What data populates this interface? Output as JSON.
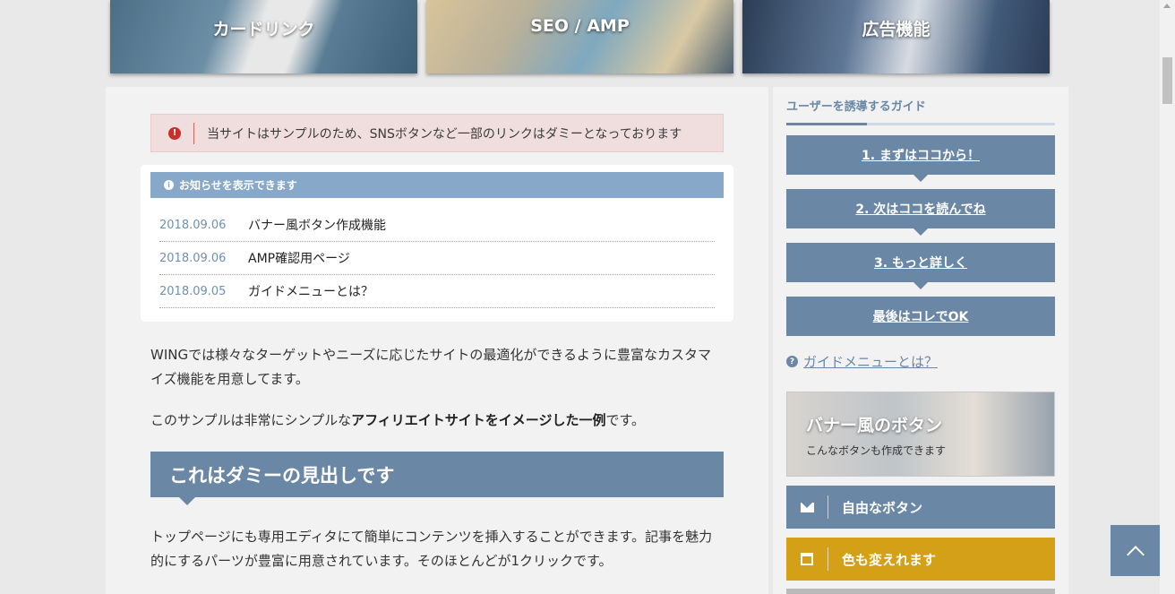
{
  "top_cards": [
    {
      "label": "カードリンク"
    },
    {
      "label": "SEO / AMP"
    },
    {
      "label": "広告機能"
    }
  ],
  "alert": {
    "icon": "exclamation-circle-icon",
    "text": "当サイトはサンプルのため、SNSボタンなど一部のリンクはダミーとなっております"
  },
  "notice": {
    "heading": "お知らせを表示できます",
    "icon": "info-circle-icon",
    "items": [
      {
        "date": "2018.09.06",
        "title": "バナー風ボタン作成機能"
      },
      {
        "date": "2018.09.06",
        "title": "AMP確認用ページ"
      },
      {
        "date": "2018.09.05",
        "title": "ガイドメニューとは？"
      }
    ]
  },
  "content": {
    "para1": "WINGでは様々なターゲットやニーズに応じたサイトの最適化ができるように豊富なカスタマイズ機能を用意してます。",
    "para2_pre": "このサンプルは非常にシンプルな",
    "para2_bold": "アフィリエイトサイトをイメージした一例",
    "para2_post": "です。",
    "heading": "これはダミーの見出しです",
    "para3": "トップページにも専用エディタにて簡単にコンテンツを挿入することができます。記事を魅力的にするパーツが豊富に用意されています。そのほとんどが1クリックです。"
  },
  "sidebar": {
    "title": "ユーザーを誘導するガイド",
    "guide_buttons": [
      {
        "label": "1. まずはココから！"
      },
      {
        "label": "2. 次はココを読んでね"
      },
      {
        "label": "3. もっと詳しく"
      },
      {
        "label": "最後はコレでOK"
      }
    ],
    "guide_link": "ガイドメニューとは？",
    "banner": {
      "title": "バナー風のボタン",
      "subtitle": "こんなボタンも作成できます"
    },
    "icon_buttons": [
      {
        "label": "自由なボタン",
        "icon": "envelope-icon",
        "color": "#6a87a6"
      },
      {
        "label": "色も変えれます",
        "icon": "calendar-icon",
        "color": "#d4a017"
      }
    ]
  },
  "colors": {
    "accent": "#6a87a6",
    "notice_head": "#87a8c9",
    "alert_bg": "#f0dede",
    "alert_icon": "#c9302c",
    "yellow_button": "#d4a017"
  }
}
